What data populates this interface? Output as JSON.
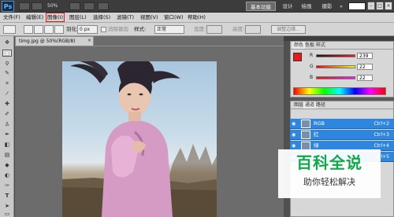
{
  "app": {
    "logo": "Ps",
    "zoom": "50%",
    "workspaces": [
      "基本功能",
      "设计",
      "绘画",
      "摄影",
      "»"
    ],
    "search_placeholder": ""
  },
  "menu": [
    "文件(F)",
    "编辑(E)",
    "图像(I)",
    "图层(L)",
    "选择(S)",
    "滤镜(T)",
    "视图(V)",
    "窗口(W)",
    "帮助(H)"
  ],
  "options": {
    "feather_label": "羽化:",
    "feather_value": "0 px",
    "antialias_label": "消除锯齿",
    "style_label": "样式:",
    "style_value": "正常",
    "width_label": "宽度:",
    "height_label": "高度:",
    "refine_edge": "调整边缘..."
  },
  "document": {
    "tab_label": "timg.jpg @ 50%(RGB/8)"
  },
  "color_panel": {
    "tabs": [
      "颜色",
      "色板",
      "样式"
    ],
    "channels": [
      {
        "label": "R",
        "value": "239"
      },
      {
        "label": "G",
        "value": "22"
      },
      {
        "label": "B",
        "value": "22"
      }
    ],
    "foreground": "#ef1616"
  },
  "layers_panel": {
    "tabs": [
      "图层",
      "通道",
      "路径"
    ],
    "channels": [
      {
        "name": "RGB",
        "shortcut": "Ctrl+2"
      },
      {
        "name": "红",
        "shortcut": "Ctrl+3"
      },
      {
        "name": "绿",
        "shortcut": "Ctrl+4"
      },
      {
        "name": "蓝",
        "shortcut": "Ctrl+5"
      }
    ]
  },
  "watermark": {
    "title": "百科全说",
    "subtitle": "助你轻松解决"
  }
}
